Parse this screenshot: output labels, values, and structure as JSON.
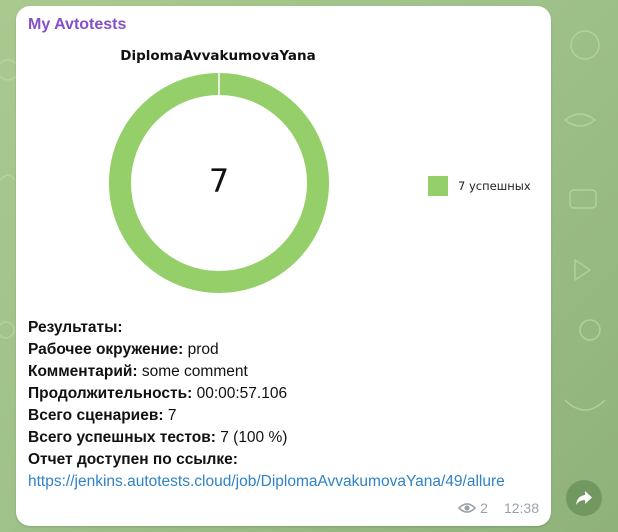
{
  "channel": {
    "title": "My Avtotests"
  },
  "chart_data": {
    "type": "pie",
    "title": "DiplomaAvvakumovaYana",
    "center_value": "7",
    "slices": [
      {
        "label": "7 успешных",
        "value": 7,
        "color": "#94cf69"
      }
    ]
  },
  "results": {
    "heading": "Результаты:",
    "env_label": "Рабочее окружение:",
    "env_value": " prod",
    "comment_label": "Комментарий:",
    "comment_value": " some comment",
    "duration_label": "Продолжительность:",
    "duration_value": " 00:00:57.106",
    "scenarios_label": "Всего сценариев:",
    "scenarios_value": " 7",
    "passed_label": "Всего успешных тестов:",
    "passed_value": " 7 (100 %)",
    "report_label": "Отчет доступен по ссылке:",
    "report_link": "https://jenkins.autotests.cloud/job/DiplomaAvvakumovaYana/49/allure"
  },
  "meta": {
    "views": "2",
    "time": "12:38"
  },
  "colors": {
    "accent": "#8650c9",
    "link": "#2f82c6",
    "slice": "#94cf69"
  },
  "icons": {
    "views": "eye-icon",
    "share": "share-arrow-icon"
  }
}
